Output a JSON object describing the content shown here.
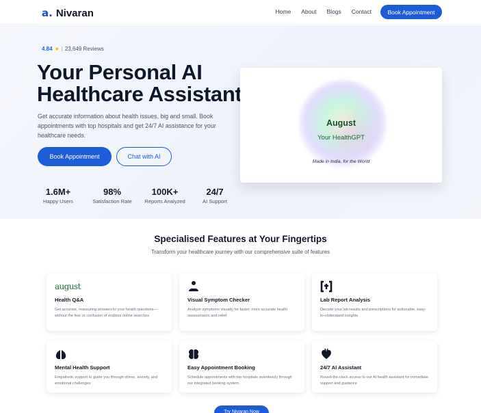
{
  "nav": {
    "logo_mark": "a.",
    "logo_text": "Nivaran",
    "links": [
      "Home",
      "About",
      "Blogs",
      "Contact"
    ],
    "cta": "Book Appointment"
  },
  "hero": {
    "rating_score": "4.84",
    "rating_star": "★",
    "rating_sep": "|",
    "rating_reviews": "23,649 Reviews",
    "title_line1": "Your Personal AI",
    "title_line2": "Healthcare Assistant",
    "subtitle": "Get accurate information about health issues, big and small. Book appointments with top hospitals and get 24/7 AI assistance for your healthcare needs.",
    "primary_button": "Book Appointment",
    "secondary_button": "Chat with AI",
    "stats": [
      {
        "value": "1.6M+",
        "label": "Happy Users"
      },
      {
        "value": "98%",
        "label": "Satisfaction Rate"
      },
      {
        "value": "100K+",
        "label": "Reports Analyzed"
      },
      {
        "value": "24/7",
        "label": "AI Support"
      }
    ]
  },
  "showcase": {
    "title": "August",
    "subtitle": "Your HealthGPT",
    "footer": "Made in India, for the World"
  },
  "features": {
    "title": "Specialised Features at Your Fingertips",
    "subtitle": "Transform your healthcare journey with our comprehensive suite of features",
    "items": [
      {
        "icon": "august-logo",
        "brand": "august",
        "title": "Health Q&A",
        "desc": "Get accurate, reassuring answers to your health questions—without the fear or confusion of endless online searches"
      },
      {
        "icon": "symptom-checker-icon",
        "title": "Visual Symptom Checker",
        "desc": "Analyze symptoms visually for faster, more accurate health assessments and relief"
      },
      {
        "icon": "lab-report-icon",
        "title": "Lab Report Analysis",
        "desc": "Decode your lab results and prescriptions for actionable, easy-to-understand insights"
      },
      {
        "icon": "lungs-icon",
        "title": "Mental Health Support",
        "desc": "Empathetic support to guide you through stress, anxiety, and emotional challenges"
      },
      {
        "icon": "brain-icon",
        "title": "Easy Appointment Booking",
        "desc": "Schedule appointments with top hospitals seamlessly through our integrated booking system"
      },
      {
        "icon": "heart-icon",
        "title": "24/7 AI Assistant",
        "desc": "Round-the-clock access to our AI health assistant for immediate support and guidance"
      }
    ]
  },
  "try_button": "Try Nivaran Now",
  "colors": {
    "accent": "#1e5bd8",
    "star": "#f5b301",
    "brand_green": "#1f6f43"
  }
}
